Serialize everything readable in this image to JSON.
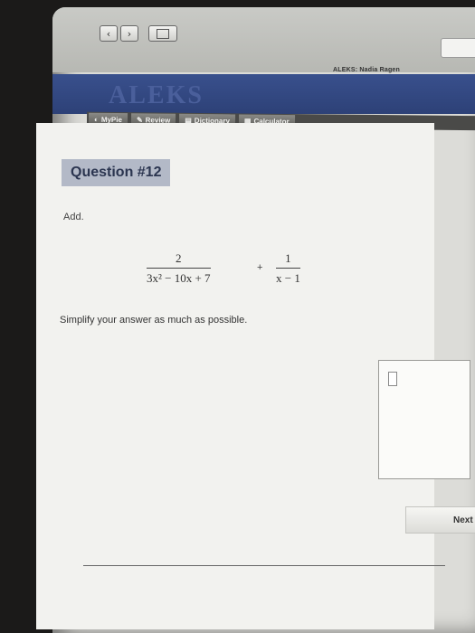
{
  "browser": {
    "back_glyph": "‹",
    "forward_glyph": "›",
    "tab_title": "ALEKS: Nadia Ragen"
  },
  "app": {
    "logo_text": "ALEKS",
    "brand_color": "#2d4177"
  },
  "tabs": [
    {
      "label": "MyPie",
      "icon": "pie-icon",
      "glyph": "◐"
    },
    {
      "label": "Review",
      "icon": "pencil-icon",
      "glyph": "✎"
    },
    {
      "label": "Dictionary",
      "icon": "book-icon",
      "glyph": "▤"
    },
    {
      "label": "Calculator",
      "icon": "calculator-icon",
      "glyph": "▦"
    }
  ],
  "question": {
    "title": "Question #12",
    "instruction": "Add.",
    "fraction1": {
      "numerator": "2",
      "denominator": "3x² − 10x + 7"
    },
    "operator": "+",
    "fraction2": {
      "numerator": "1",
      "denominator": "x − 1"
    },
    "prompt": "Simplify your answer as much as possible."
  },
  "answer": {
    "value": ""
  },
  "actions": {
    "next_label": "Next"
  }
}
